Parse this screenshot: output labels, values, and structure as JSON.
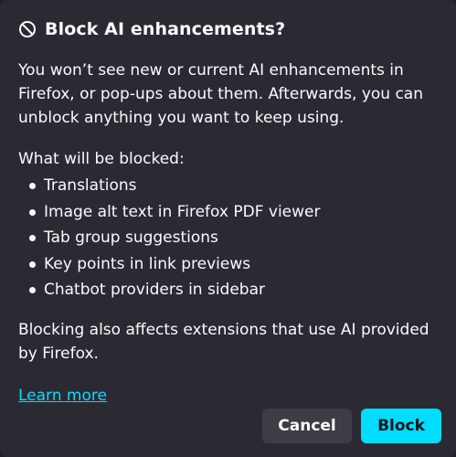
{
  "dialog": {
    "icon": "block-icon",
    "title": "Block AI enhancements?",
    "intro": "You won’t see new or current AI enhancements in Firefox, or pop-ups about them. Afterwards, you can unblock anything you want to keep using.",
    "blocked_heading": "What will be blocked:",
    "blocked_items": [
      "Translations",
      "Image alt text in Firefox PDF viewer",
      "Tab group suggestions",
      "Key points in link previews",
      "Chatbot providers in sidebar"
    ],
    "note": "Blocking also affects extensions that use AI provided by Firefox.",
    "learn_more": "Learn more",
    "cancel_label": "Cancel",
    "block_label": "Block"
  },
  "colors": {
    "background": "#2b2a33",
    "text": "#fbfbfe",
    "accent": "#00ddff",
    "secondary_button": "#3e3d45"
  }
}
